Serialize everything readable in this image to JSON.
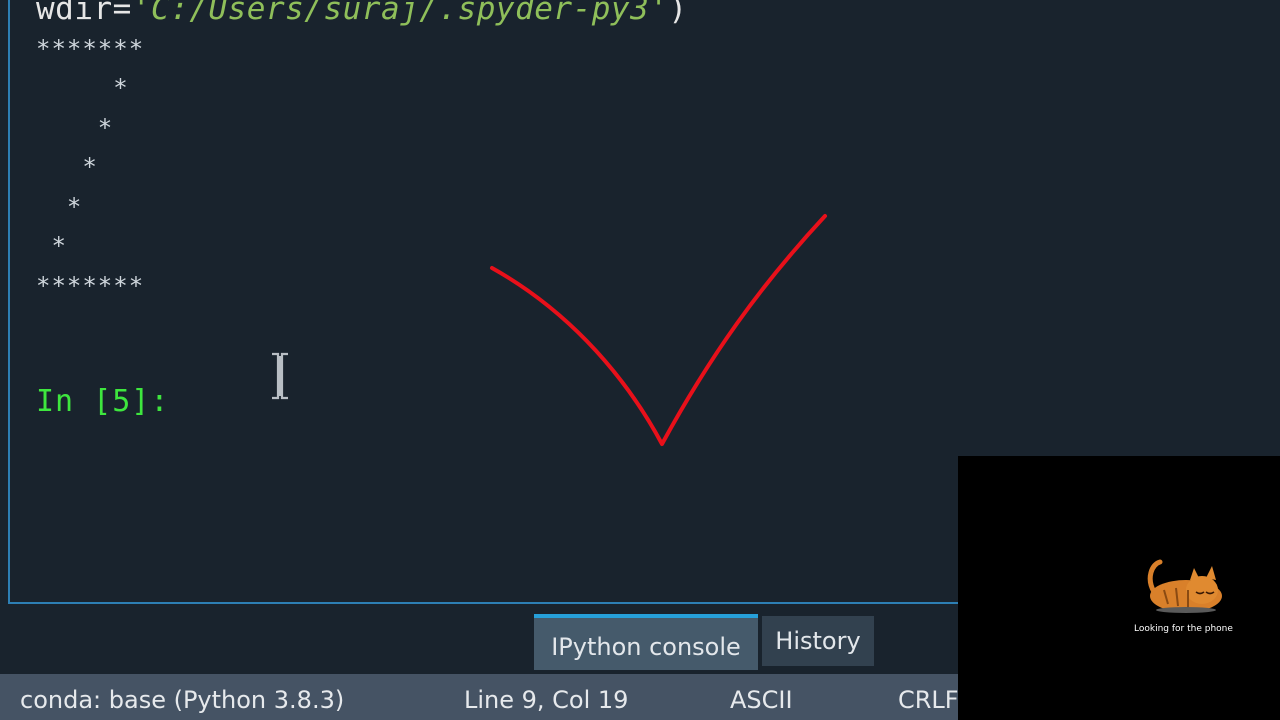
{
  "console": {
    "wdir_prefix": "wdir=",
    "wdir_value": "'C:/Users/suraj/.spyder-py3'",
    "wdir_suffix": ")",
    "output_lines": [
      "*******",
      "     *",
      "    *",
      "   *",
      "  *",
      " *",
      "*******"
    ],
    "prompt": "In [5]:"
  },
  "tabs": {
    "ipython_console": "IPython console",
    "history": "History"
  },
  "status_bar": {
    "env": "conda: base (Python 3.8.3)",
    "position": "Line 9, Col 19",
    "encoding": "ASCII",
    "eol": "CRLF"
  },
  "overlay": {
    "caption": "Looking for the phone"
  },
  "icons": {
    "checkmark": "checkmark-icon",
    "cursor": "text-cursor-icon",
    "cat": "sleeping-cat-icon"
  },
  "colors": {
    "background": "#19232d",
    "prompt_green": "#3ee63e",
    "string_green": "#8fbf5a",
    "checkmark_red": "#e8101a",
    "tab_accent": "#26a0da",
    "status_bar": "#455364"
  }
}
